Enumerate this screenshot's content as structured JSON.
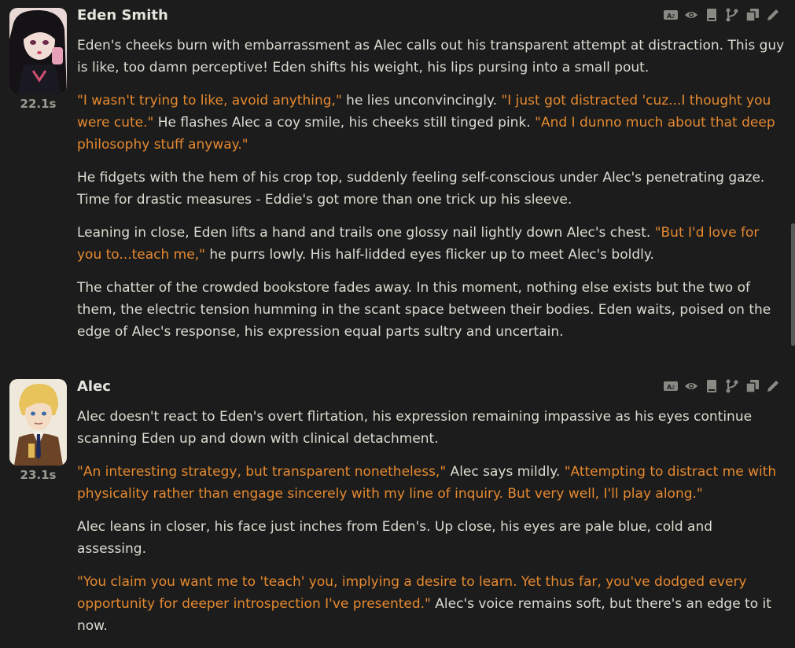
{
  "messages": [
    {
      "name": "Eden Smith",
      "timer": "22.1s",
      "avatar_icon": "eden-avatar",
      "paragraphs": [
        [
          {
            "t": "Eden's cheeks burn with embarrassment as Alec calls out his transparent attempt at distraction. This guy is like, too damn perceptive! Eden shifts his weight, his lips pursing into a small pout.",
            "q": false
          }
        ],
        [
          {
            "t": "\"I wasn't trying to like, avoid anything,\"",
            "q": true
          },
          {
            "t": " he lies unconvincingly. ",
            "q": false
          },
          {
            "t": "\"I just got distracted 'cuz...I thought you were cute.\"",
            "q": true
          },
          {
            "t": " He flashes Alec a coy smile, his cheeks still tinged pink. ",
            "q": false
          },
          {
            "t": "\"And I dunno much about that deep philosophy stuff anyway.\"",
            "q": true
          }
        ],
        [
          {
            "t": "He fidgets with the hem of his crop top, suddenly feeling self-conscious under Alec's penetrating gaze. Time for drastic measures - Eddie's got more than one trick up his sleeve.",
            "q": false
          }
        ],
        [
          {
            "t": "Leaning in close, Eden lifts a hand and trails one glossy nail lightly down Alec's chest. ",
            "q": false
          },
          {
            "t": "\"But I'd love for you to...teach me,\"",
            "q": true
          },
          {
            "t": " he purrs lowly. His half-lidded eyes flicker up to meet Alec's boldly.",
            "q": false
          }
        ],
        [
          {
            "t": "The chatter of the crowded bookstore fades away. In this moment, nothing else exists but the two of them, the electric tension humming in the scant space between their bodies. Eden waits, poised on the edge of Alec's response, his expression equal parts sultry and uncertain.",
            "q": false
          }
        ]
      ]
    },
    {
      "name": "Alec",
      "timer": "23.1s",
      "avatar_icon": "alec-avatar",
      "paragraphs": [
        [
          {
            "t": "Alec doesn't react to Eden's overt flirtation, his expression remaining impassive as his eyes continue scanning Eden up and down with clinical detachment.",
            "q": false
          }
        ],
        [
          {
            "t": "\"An interesting strategy, but transparent nonetheless,\"",
            "q": true
          },
          {
            "t": " Alec says mildly. ",
            "q": false
          },
          {
            "t": "\"Attempting to distract me with physicality rather than engage sincerely with my line of inquiry. But very well, I'll play along.\"",
            "q": true
          }
        ],
        [
          {
            "t": "Alec leans in closer, his face just inches from Eden's. Up close, his eyes are pale blue, cold and assessing.",
            "q": false
          }
        ],
        [
          {
            "t": "\"You claim you want me to 'teach' you, implying a desire to learn. Yet thus far, you've dodged every opportunity for deeper introspection I've presented.\"",
            "q": true
          },
          {
            "t": " Alec's voice remains soft, but there's an edge to it now.",
            "q": false
          }
        ]
      ]
    }
  ],
  "action_icons": [
    "translate-icon",
    "eye-icon",
    "bookmark-icon",
    "branch-icon",
    "copy-icon",
    "edit-icon"
  ],
  "colors": {
    "background": "#1c1c1c",
    "text": "#dcdcd2",
    "quote": "#e5892f",
    "timer": "#9a9a92",
    "icon": "#8a8a84"
  }
}
